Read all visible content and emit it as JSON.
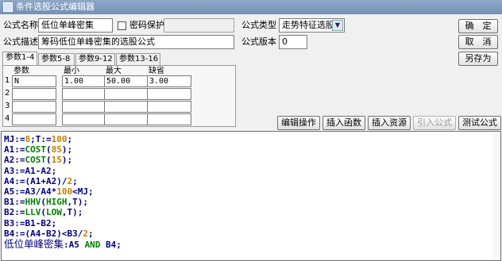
{
  "window": {
    "title": "条件选股公式编辑器"
  },
  "form": {
    "name_label": "公式名称",
    "name_value": "低位单峰密集",
    "password_label": "密码保护",
    "password_checked": false,
    "type_label": "公式类型",
    "type_value": "走势特征选股",
    "desc_label": "公式描述",
    "desc_value": "筹码低位单峰密集的选股公式",
    "version_label": "公式版本",
    "version_value": "0"
  },
  "buttons": {
    "confirm": "确　定",
    "cancel": "取　消",
    "save_as": "另存为",
    "edit_ops": "编辑操作",
    "insert_func": "插入函数",
    "insert_res": "插入资源",
    "import_formula": "引入公式",
    "test_formula": "测试公式"
  },
  "tabs": [
    "参数1-4",
    "参数5-8",
    "参数9-12",
    "参数13-16"
  ],
  "params": {
    "headers": [
      "参数",
      "最小",
      "最大",
      "缺省"
    ],
    "rows": [
      {
        "num": "1",
        "name": "N",
        "min": "1.00",
        "max": "50.00",
        "def": "3.00"
      },
      {
        "num": "2",
        "name": "",
        "min": "",
        "max": "",
        "def": ""
      },
      {
        "num": "3",
        "name": "",
        "min": "",
        "max": "",
        "def": ""
      },
      {
        "num": "4",
        "name": "",
        "min": "",
        "max": "",
        "def": ""
      }
    ]
  },
  "code": {
    "lines": [
      [
        [
          "MJ:=",
          "id"
        ],
        [
          "8",
          "num"
        ],
        [
          ";T:=",
          "id"
        ],
        [
          "100",
          "num"
        ],
        [
          ";",
          "id"
        ]
      ],
      [
        [
          "A1:=",
          "id"
        ],
        [
          "COST",
          "fn"
        ],
        [
          "(",
          "id"
        ],
        [
          "85",
          "num"
        ],
        [
          ");",
          "id"
        ]
      ],
      [
        [
          "A2:=",
          "id"
        ],
        [
          "COST",
          "fn"
        ],
        [
          "(",
          "id"
        ],
        [
          "15",
          "num"
        ],
        [
          ");",
          "id"
        ]
      ],
      [
        [
          "A3:=A1-A2;",
          "id"
        ]
      ],
      [
        [
          "A4:=(A1+A2)/",
          "id"
        ],
        [
          "2",
          "num"
        ],
        [
          ";",
          "id"
        ]
      ],
      [
        [
          "A5:=A3/A4*",
          "id"
        ],
        [
          "100",
          "num"
        ],
        [
          "<MJ;",
          "id"
        ]
      ],
      [
        [
          "B1:=",
          "id"
        ],
        [
          "HHV",
          "fn"
        ],
        [
          "(",
          "id"
        ],
        [
          "HIGH",
          "fn"
        ],
        [
          ",T);",
          "id"
        ]
      ],
      [
        [
          "B2:=",
          "id"
        ],
        [
          "LLV",
          "fn"
        ],
        [
          "(",
          "id"
        ],
        [
          "LOW",
          "fn"
        ],
        [
          ",T);",
          "id"
        ]
      ],
      [
        [
          "B3:=B1-B2;",
          "id"
        ]
      ],
      [
        [
          "B4:=(A4-B2)<B3/",
          "id"
        ],
        [
          "2",
          "num"
        ],
        [
          ";",
          "id"
        ]
      ],
      [
        [
          "低位单峰密集",
          "id"
        ],
        [
          ":A5 ",
          "op"
        ],
        [
          "AND",
          "kw"
        ],
        [
          " B4;",
          "op"
        ]
      ]
    ],
    "colors": {
      "id": "#000080",
      "num": "#c08000",
      "fn": "#008000",
      "kw": "#008000",
      "op": "#000080"
    }
  }
}
